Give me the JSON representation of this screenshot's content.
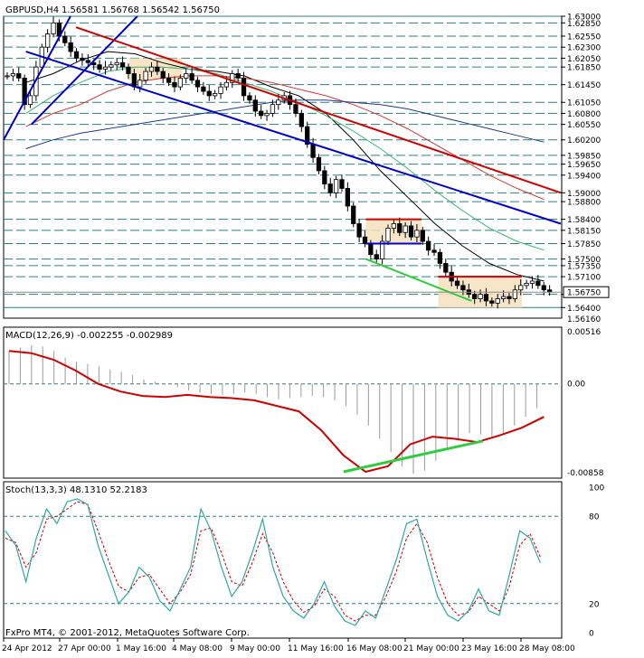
{
  "window": {
    "symbol_header": "GBPUSD,H4",
    "ohlc": "1.56581 1.56768 1.56542 1.56750",
    "copyright": "FxPro MT4, © 2001-2012, MetaQuotes Software Corp."
  },
  "chart_data": [
    {
      "type": "candlestick",
      "name": "price",
      "symbol": "GBPUSD",
      "timeframe": "H4",
      "ylim": [
        1.5616,
        1.63
      ],
      "price_levels": [
        1.63,
        1.6285,
        1.6255,
        1.623,
        1.6205,
        1.6185,
        1.6145,
        1.6105,
        1.608,
        1.6055,
        1.602,
        1.5985,
        1.5965,
        1.594,
        1.59,
        1.588,
        1.584,
        1.5815,
        1.5785,
        1.575,
        1.5735,
        1.571,
        1.567,
        1.564
      ],
      "price_labels": [
        "1.63000",
        "1.62850",
        "1.62550",
        "1.62300",
        "1.62050",
        "1.61850",
        "1.61450",
        "1.61050",
        "1.60800",
        "1.60550",
        "1.60200",
        "1.59850",
        "1.59650",
        "1.59400",
        "1.59000",
        "1.58800",
        "1.58400",
        "1.58150",
        "1.57850",
        "1.57500",
        "1.57350",
        "1.57100",
        "1.56700",
        "1.56400"
      ],
      "current_price_label": "1.56750",
      "current_price": 1.5675,
      "bottom_label": "1.56160",
      "x_labels": [
        "24 Apr 2012",
        "27 Apr 00:00",
        "1 May 16:00",
        "4 May 08:00",
        "9 May 00:00",
        "11 May 16:00",
        "16 May 08:00",
        "21 May 00:00",
        "23 May 16:00",
        "28 May 08:00"
      ],
      "close_path": [
        1.6165,
        1.617,
        1.616,
        1.61,
        1.612,
        1.6185,
        1.623,
        1.626,
        1.6285,
        1.6255,
        1.624,
        1.622,
        1.6205,
        1.62,
        1.6195,
        1.619,
        1.618,
        1.6185,
        1.619,
        1.6195,
        1.6185,
        1.617,
        1.614,
        1.6155,
        1.6175,
        1.6185,
        1.6175,
        1.616,
        1.615,
        1.614,
        1.616,
        1.617,
        1.6155,
        1.614,
        1.613,
        1.612,
        1.6125,
        1.614,
        1.615,
        1.617,
        1.616,
        1.612,
        1.611,
        1.6085,
        1.6075,
        1.608,
        1.61,
        1.611,
        1.612,
        1.61,
        1.608,
        1.605,
        1.601,
        1.598,
        1.595,
        1.592,
        1.59,
        1.593,
        1.591,
        1.587,
        1.583,
        1.58,
        1.5785,
        1.576,
        1.575,
        1.579,
        1.582,
        1.583,
        1.581,
        1.5825,
        1.58,
        1.5815,
        1.579,
        1.577,
        1.5765,
        1.574,
        1.572,
        1.57,
        1.569,
        1.568,
        1.567,
        1.566,
        1.567,
        1.5655,
        1.565,
        1.566,
        1.5665,
        1.566,
        1.568,
        1.569,
        1.5695,
        1.57,
        1.569,
        1.568,
        1.5675
      ],
      "moving_averages": [
        {
          "color": "#000000",
          "values": [
            1.615,
            1.617,
            1.62,
            1.622,
            1.6215,
            1.6195,
            1.618,
            1.6175,
            1.6165,
            1.614,
            1.612,
            1.608,
            1.602,
            1.595,
            1.589,
            1.583,
            1.578,
            1.574,
            1.5715,
            1.57
          ]
        },
        {
          "color": "#3cb371",
          "values": [
            1.608,
            1.612,
            1.615,
            1.6175,
            1.6185,
            1.6185,
            1.618,
            1.617,
            1.615,
            1.613,
            1.6105,
            1.6075,
            1.604,
            1.6,
            1.5955,
            1.5905,
            1.586,
            1.582,
            1.579,
            1.577
          ]
        },
        {
          "color": "#cd3c3c",
          "values": [
            1.605,
            1.608,
            1.61,
            1.613,
            1.615,
            1.616,
            1.6165,
            1.6165,
            1.616,
            1.615,
            1.6135,
            1.612,
            1.61,
            1.6075,
            1.6045,
            1.601,
            1.5975,
            1.594,
            1.591,
            1.5885
          ]
        },
        {
          "color": "#1e3a8a",
          "values": [
            1.6,
            1.602,
            1.6035,
            1.6045,
            1.6055,
            1.6065,
            1.6075,
            1.6085,
            1.6095,
            1.6105,
            1.611,
            1.611,
            1.6105,
            1.61,
            1.609,
            1.6075,
            1.606,
            1.6045,
            1.603,
            1.6015
          ]
        }
      ],
      "trendlines": [
        {
          "color": "#0000cc",
          "from": [
            0.0,
            1.602
          ],
          "to": [
            0.12,
            1.63
          ]
        },
        {
          "color": "#0000cc",
          "from": [
            0.05,
            1.6055
          ],
          "to": [
            0.24,
            1.63
          ]
        },
        {
          "color": "#0000cc",
          "from": [
            0.04,
            1.622
          ],
          "to": [
            1.0,
            1.583
          ]
        },
        {
          "color": "#cc0000",
          "from": [
            0.13,
            1.6275
          ],
          "to": [
            1.0,
            1.59
          ]
        },
        {
          "color": "#2ecc40",
          "from": [
            0.65,
            1.575
          ],
          "to": [
            0.84,
            1.5655
          ]
        },
        {
          "color": "#cc0000",
          "from": [
            0.78,
            1.571
          ],
          "to": [
            0.93,
            1.571
          ]
        },
        {
          "color": "#cc0000",
          "from": [
            0.65,
            1.584
          ],
          "to": [
            0.75,
            1.584
          ]
        },
        {
          "color": "#0000cc",
          "from": [
            0.65,
            1.5785
          ],
          "to": [
            0.75,
            1.5785
          ]
        }
      ],
      "boxes": [
        {
          "fill": "#f6e0bd",
          "x": [
            0.78,
            0.93
          ],
          "y": [
            1.564,
            1.571
          ]
        },
        {
          "fill": "#f6e0bd",
          "x": [
            0.65,
            0.75
          ],
          "y": [
            1.5785,
            1.584
          ]
        },
        {
          "fill": "#f6e0bd",
          "x": [
            0.225,
            0.32
          ],
          "y": [
            1.6155,
            1.6205
          ]
        }
      ]
    },
    {
      "type": "histogram+line",
      "name": "macd",
      "title": "MACD(12,26,9) -0.002255 -0.002989",
      "ylim": [
        -0.00858,
        0.00516
      ],
      "y_labels": [
        "0.00516",
        "0.00",
        "-0.00858"
      ],
      "histogram": [
        0.003,
        0.0033,
        0.0035,
        0.0034,
        0.003,
        0.0024,
        0.002,
        0.0018,
        0.0016,
        0.0013,
        0.0011,
        0.0008,
        0.0004,
        0.0002,
        0.0,
        -0.0003,
        -0.0006,
        -0.0008,
        -0.0009,
        -0.001,
        -0.0009,
        -0.0008,
        -0.0009,
        -0.0012,
        -0.0014,
        -0.0013,
        -0.0012,
        -0.0011,
        -0.0012,
        -0.0015,
        -0.002,
        -0.0028,
        -0.0038,
        -0.005,
        -0.0062,
        -0.0075,
        -0.0082,
        -0.0079,
        -0.007,
        -0.006,
        -0.005,
        -0.0045,
        -0.0046,
        -0.0048,
        -0.0045,
        -0.0038,
        -0.003,
        -0.0022
      ],
      "signal": [
        0.003,
        0.0028,
        0.0022,
        0.0012,
        0.0,
        -0.0007,
        -0.0011,
        -0.0012,
        -0.001,
        -0.0012,
        -0.0013,
        -0.0015,
        -0.002,
        -0.0025,
        -0.0042,
        -0.0065,
        -0.008,
        -0.0075,
        -0.0055,
        -0.0048,
        -0.005,
        -0.0053,
        -0.0047,
        -0.004,
        -0.003
      ],
      "trendline": {
        "color": "#2ecc40",
        "from": [
          0.61,
          -0.008
        ],
        "to": [
          0.86,
          -0.0052
        ]
      }
    },
    {
      "type": "line",
      "name": "stochastic",
      "title": "Stoch(13,3,3) 48.1310 52.2183",
      "ylim": [
        0,
        100
      ],
      "y_labels": [
        "100",
        "80",
        "20",
        "0"
      ],
      "k_color": "#2fa7a7",
      "d_color": "#cc0000",
      "k": [
        70,
        60,
        35,
        65,
        85,
        75,
        90,
        92,
        88,
        60,
        40,
        20,
        28,
        45,
        38,
        22,
        15,
        30,
        45,
        85,
        70,
        45,
        25,
        35,
        55,
        78,
        45,
        25,
        15,
        10,
        20,
        35,
        18,
        8,
        5,
        15,
        10,
        30,
        50,
        75,
        78,
        50,
        25,
        12,
        8,
        15,
        30,
        15,
        12,
        40,
        70,
        65,
        48
      ],
      "d": [
        65,
        62,
        45,
        55,
        78,
        80,
        85,
        90,
        88,
        70,
        50,
        32,
        28,
        38,
        40,
        30,
        20,
        28,
        40,
        70,
        72,
        55,
        35,
        32,
        48,
        68,
        55,
        35,
        22,
        14,
        18,
        30,
        25,
        12,
        8,
        12,
        12,
        25,
        42,
        65,
        75,
        62,
        38,
        20,
        12,
        14,
        25,
        20,
        15,
        32,
        60,
        68,
        52
      ]
    }
  ]
}
